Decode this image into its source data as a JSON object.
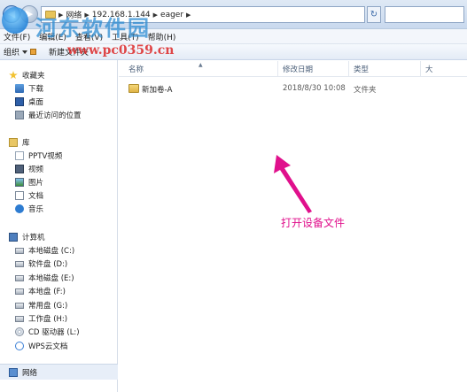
{
  "address_bar": {
    "breadcrumbs": [
      "网络",
      "192.168.1.144",
      "eager"
    ]
  },
  "menu": {
    "items": [
      "文件(F)",
      "编辑(E)",
      "查看(V)",
      "工具(T)",
      "帮助(H)"
    ]
  },
  "toolbar": {
    "organize_label": "组织",
    "new_folder_label": "新建文件夹"
  },
  "watermark": {
    "title": "河东软件园",
    "url": "www.pc0359.cn"
  },
  "navigation": {
    "favorites": {
      "label": "收藏夹",
      "items": [
        {
          "label": "下载",
          "icon": "download-icon"
        },
        {
          "label": "桌面",
          "icon": "desktop-icon"
        },
        {
          "label": "最近访问的位置",
          "icon": "recent-places-icon"
        }
      ]
    },
    "libraries": {
      "label": "库",
      "items": [
        {
          "label": "PPTV视频",
          "icon": "pptv-icon"
        },
        {
          "label": "视频",
          "icon": "video-icon"
        },
        {
          "label": "图片",
          "icon": "picture-icon"
        },
        {
          "label": "文档",
          "icon": "document-icon"
        },
        {
          "label": "音乐",
          "icon": "music-icon"
        }
      ]
    },
    "computer": {
      "label": "计算机",
      "items": [
        {
          "label": "本地磁盘 (C:)",
          "icon": "drive-icon"
        },
        {
          "label": "软件盘 (D:)",
          "icon": "drive-icon"
        },
        {
          "label": "本地磁盘 (E:)",
          "icon": "drive-icon"
        },
        {
          "label": "本地盘 (F:)",
          "icon": "drive-icon"
        },
        {
          "label": "常用盘 (G:)",
          "icon": "drive-icon"
        },
        {
          "label": "工作盘 (H:)",
          "icon": "drive-icon"
        },
        {
          "label": "CD 驱动器 (L:)",
          "icon": "cd-drive-icon"
        },
        {
          "label": "WPS云文档",
          "icon": "cloud-icon"
        }
      ]
    },
    "network": {
      "label": "网络"
    }
  },
  "columns": {
    "name": "名称",
    "modified": "修改日期",
    "type": "类型",
    "size": "大"
  },
  "files": [
    {
      "name": "新加卷-A",
      "modified": "2018/8/30 10:08",
      "type": "文件夹"
    }
  ],
  "annotation": {
    "text": "打开设备文件",
    "color": "#e0108c"
  }
}
